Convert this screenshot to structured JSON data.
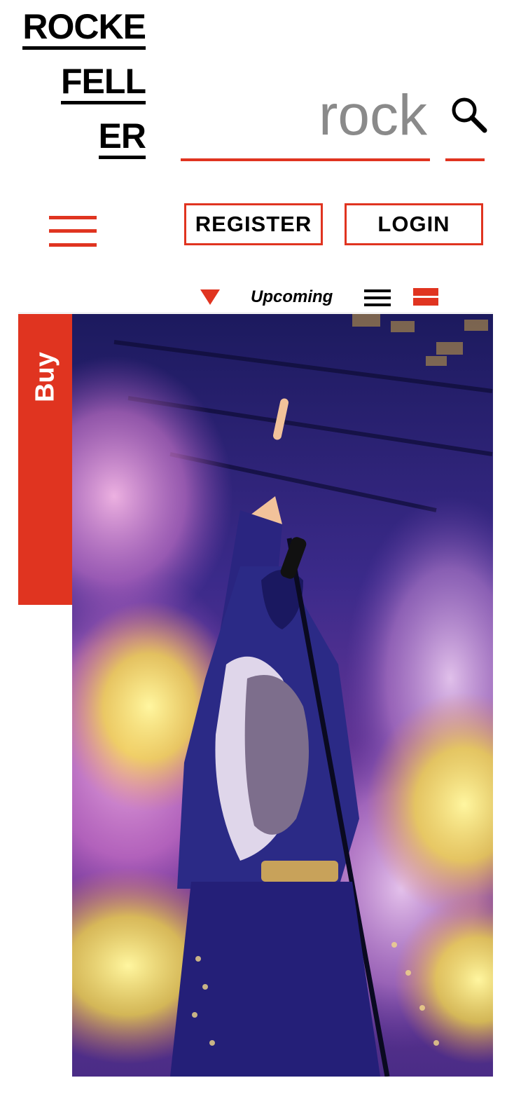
{
  "logo": {
    "line1": "ROCKE",
    "line2": "FELL",
    "line3": "ER"
  },
  "search": {
    "value": "rock"
  },
  "header": {
    "register_label": "REGISTER",
    "login_label": "LOGIN"
  },
  "filter": {
    "label": "Upcoming"
  },
  "event": {
    "buy_label": "Buy"
  },
  "colors": {
    "accent": "#e03420",
    "text": "#000000",
    "search_text": "#8a8a8a"
  },
  "icons": [
    "search-icon",
    "menu-icon",
    "dropdown-triangle-icon",
    "list-view-icon",
    "grid-view-icon"
  ]
}
